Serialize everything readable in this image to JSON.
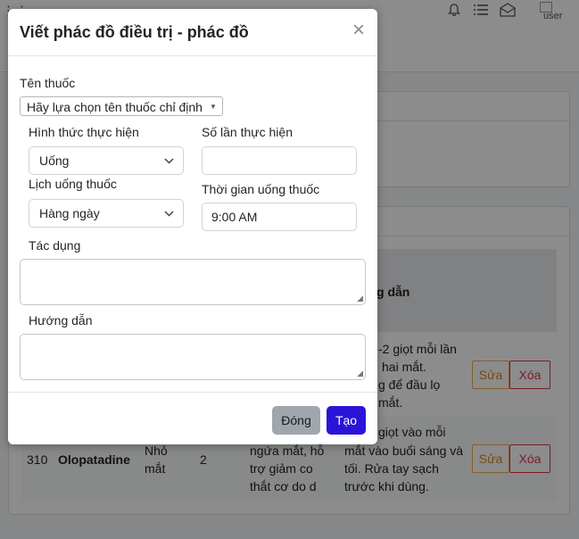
{
  "background": {
    "user_alt": "user",
    "table": {
      "header_fragment": "g dẫn",
      "row1": {
        "guide_text": [
          "-2 giọt mỗi lần",
          "hai mắt.",
          "g để đầu lọ",
          "mắt."
        ],
        "edit_label": "Sửa",
        "delete_label": "Xóa"
      },
      "row2": {
        "id": "310",
        "name": "Olopatadine",
        "type": [
          "Nhỏ",
          "mắt"
        ],
        "count": "2",
        "effect": [
          "ngứa mắt, hỗ",
          "trợ giảm co",
          "thắt cơ do d"
        ],
        "guide_text": [
          "giọt vào mỗi",
          "mắt vào buổi sáng và",
          "tối. Rửa tay sạch",
          "trước khi dùng."
        ],
        "edit_label": "Sửa",
        "delete_label": "Xóa"
      }
    }
  },
  "modal": {
    "title": "Viết phác đồ điều trị - phác đồ",
    "close_symbol": "×",
    "drug_name_label": "Tên thuốc",
    "drug_select_value": "Hãy lựa chọn tên thuốc chỉ định",
    "method_label": "Hình thức thực hiện",
    "method_value": "Uống",
    "times_label": "Số lần thực hiện",
    "times_value": "",
    "schedule_label": "Lịch uống thuốc",
    "schedule_value": "Hàng ngày",
    "time_label": "Thời gian uống thuốc",
    "time_value": "9:00 AM",
    "effect_label": "Tác dụng",
    "effect_value": "",
    "guide_label": "Hướng dẫn",
    "guide_value": "",
    "close_button": "Đóng",
    "create_button": "Tạo"
  },
  "colors": {
    "create_button": "#2a14d8",
    "close_button": "#a0a6ad",
    "edit_border": "#f0ad4e",
    "delete_border": "#dc3545"
  }
}
